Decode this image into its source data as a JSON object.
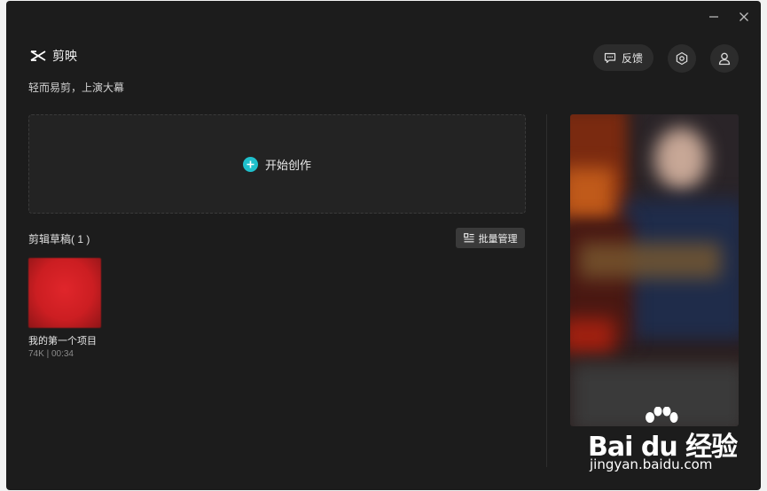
{
  "window": {
    "brand_name": "剪映",
    "tagline": "轻而易剪，上演大幕"
  },
  "header": {
    "feedback_label": "反馈"
  },
  "create": {
    "label": "开始创作"
  },
  "drafts": {
    "title": "剪辑草稿( 1 )",
    "batch_label": "批量管理",
    "items": [
      {
        "name": "我的第一个项目",
        "meta": "74K | 00:34"
      }
    ]
  },
  "watermark": {
    "logo_text": "Bai du 经验",
    "url": "jingyan.baidu.com"
  },
  "colors": {
    "background": "#1c1c1c",
    "accent": "#1fc0cc",
    "thumbnail": "#d42025"
  },
  "icons": {
    "minimize": "minimize-icon",
    "close": "close-icon",
    "logo": "capcut-logo-icon",
    "feedback": "chat-bubble-icon",
    "settings": "hexagon-settings-icon",
    "user": "user-icon",
    "create": "plus-circle-icon",
    "batch": "list-manage-icon"
  }
}
